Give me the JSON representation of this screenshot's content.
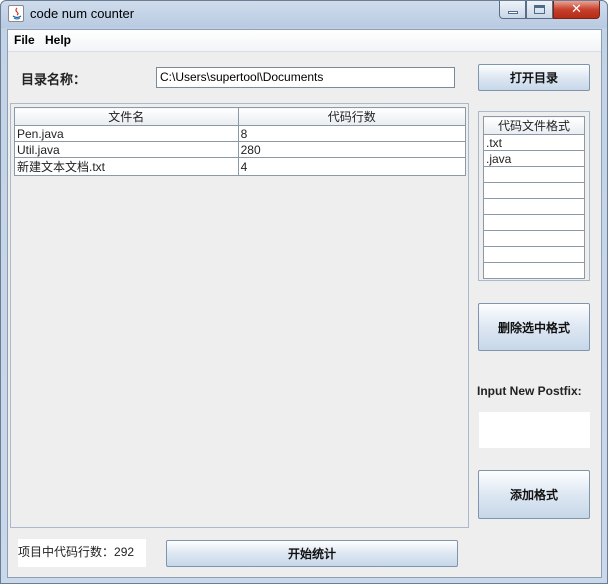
{
  "window": {
    "title": "code num counter"
  },
  "menu": {
    "items": [
      "File",
      "Help"
    ]
  },
  "directory": {
    "label": "目录名称：",
    "path": "C:\\Users\\supertool\\Documents",
    "open_button": "打开目录"
  },
  "files_table": {
    "columns": [
      "文件名",
      "代码行数"
    ],
    "rows": [
      [
        "Pen.java",
        "8"
      ],
      [
        "Util.java",
        "280"
      ],
      [
        "新建文本文档.txt",
        "4"
      ]
    ]
  },
  "formats": {
    "header": "代码文件格式",
    "items": [
      ".txt",
      ".java",
      "",
      "",
      "",
      "",
      "",
      "",
      ""
    ],
    "delete_button": "删除选中格式"
  },
  "postfix": {
    "label": "Input New Postfix:",
    "value": "",
    "add_button": "添加格式"
  },
  "summary": {
    "count_label": "项目中代码行数：",
    "count_value": "292",
    "start_button": "开始统计"
  }
}
